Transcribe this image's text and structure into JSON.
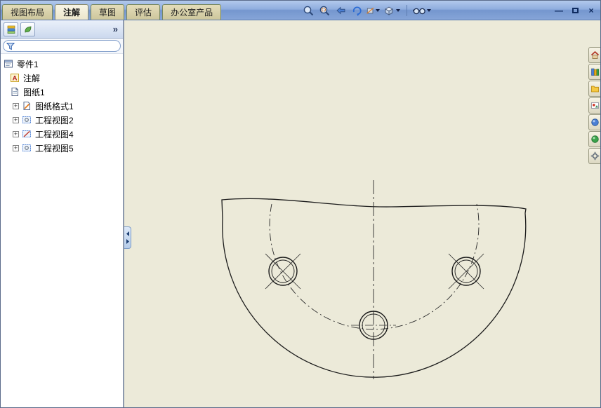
{
  "ribbon": {
    "tabs": [
      {
        "label": "视图布局"
      },
      {
        "label": "注解"
      },
      {
        "label": "草图"
      },
      {
        "label": "评估"
      },
      {
        "label": "办公室产品"
      }
    ],
    "active_tab": "注解"
  },
  "window_controls": {
    "minimize": "—",
    "close": "×"
  },
  "left_panel": {
    "chevron": "»",
    "filter_value": ""
  },
  "tree": {
    "items": [
      {
        "label": "零件1",
        "expander": ""
      },
      {
        "label": "注解",
        "expander": ""
      },
      {
        "label": "图纸1",
        "expander": ""
      },
      {
        "label": "图纸格式1",
        "expander": "+"
      },
      {
        "label": "工程视图2",
        "expander": "+"
      },
      {
        "label": "工程视图4",
        "expander": "+"
      },
      {
        "label": "工程视图5",
        "expander": "+"
      }
    ]
  },
  "colors": {
    "canvas_bg": "#ecead9",
    "ribbon_gradient_top": "#b2c9ec",
    "ribbon_gradient_bottom": "#7496ce",
    "tab_inactive": "#d6cfa6",
    "tab_active": "#f4f0dc"
  }
}
